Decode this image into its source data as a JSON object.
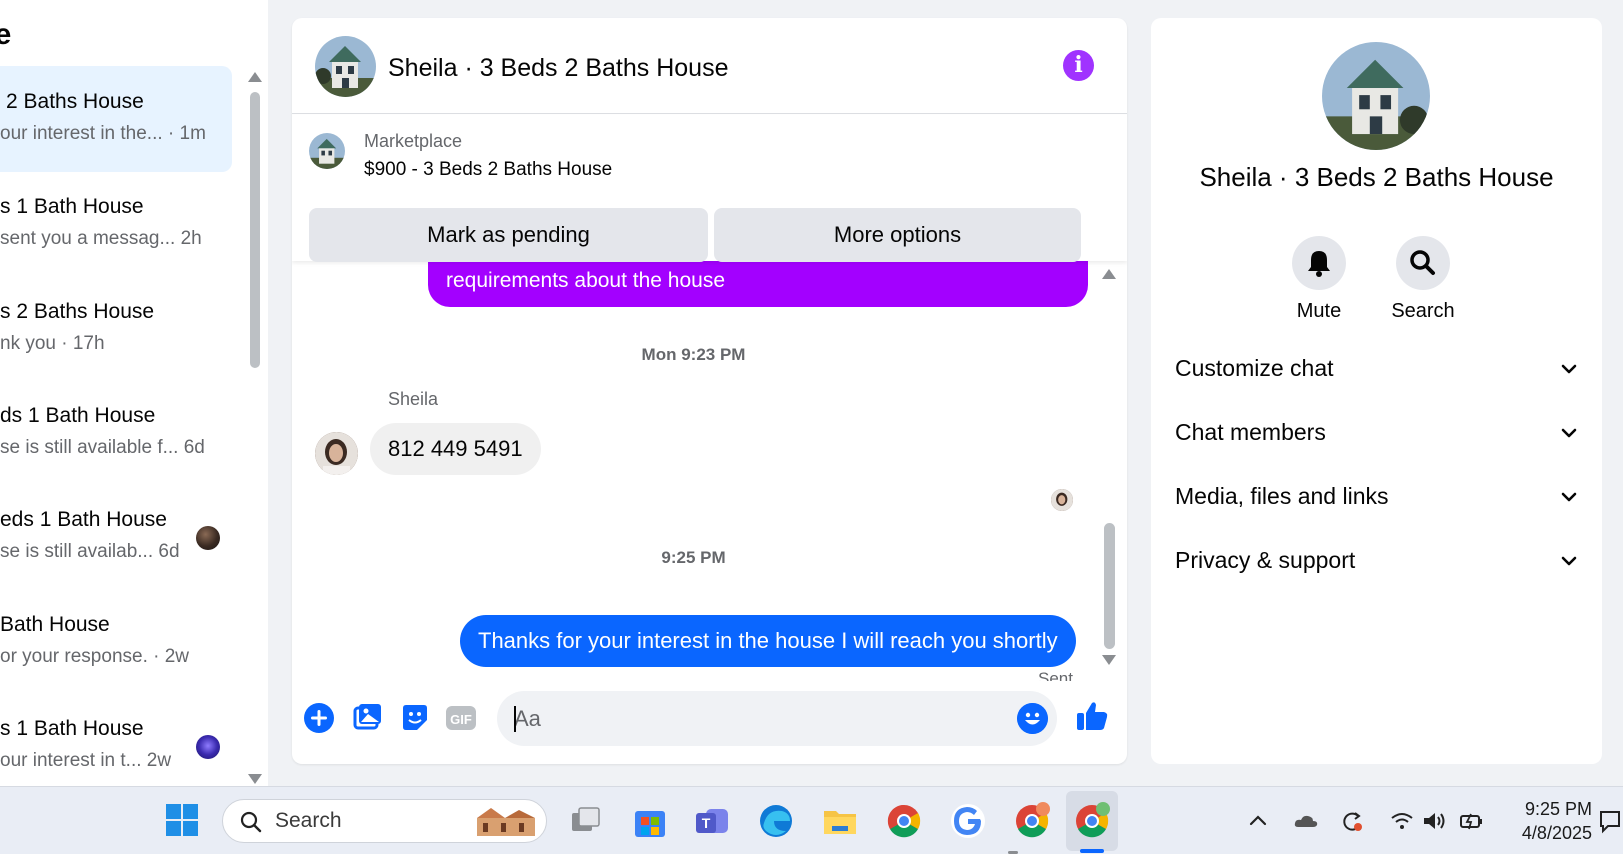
{
  "sidebar": {
    "title": "ce",
    "conversations": [
      {
        "name": "2 Baths House",
        "preview": "our interest in the... · 1m",
        "active": true
      },
      {
        "name": "s 1 Bath House",
        "preview": "sent you a messag... 2h"
      },
      {
        "name": "s 2 Baths House",
        "preview": "nk you · 17h"
      },
      {
        "name": "ds 1 Bath House",
        "preview": "se is still available f... 6d"
      },
      {
        "name": "eds 1 Bath House",
        "preview": "se is still availab... 6d"
      },
      {
        "name": "Bath House",
        "preview": "or your response. · 2w"
      },
      {
        "name": "s 1 Bath House",
        "preview": "our interest in t... 2w"
      }
    ]
  },
  "chat": {
    "title": "Sheila · 3 Beds 2 Baths House",
    "marketplace_label": "Marketplace",
    "listing": "$900 - 3 Beds 2 Baths House",
    "mark_pending_label": "Mark as pending",
    "more_options_label": "More options",
    "messages": {
      "partial_out": "requirements about the house",
      "time1": "Mon 9:23 PM",
      "sender": "Sheila",
      "incoming": "812 449 5491",
      "time2": "9:25 PM",
      "outgoing": "Thanks for your interest in the house I will reach you shortly",
      "status": "Sent"
    },
    "composer_placeholder": "Aa",
    "accent_color": "#0a66ff",
    "purple_color": "#a300ff"
  },
  "info": {
    "name": "Sheila · 3 Beds 2 Baths House",
    "actions": {
      "mute": "Mute",
      "search": "Search"
    },
    "sections": [
      "Customize chat",
      "Chat members",
      "Media, files and links",
      "Privacy & support"
    ]
  },
  "taskbar": {
    "search_placeholder": "Search",
    "time": "9:25 PM",
    "date": "4/8/2025"
  }
}
